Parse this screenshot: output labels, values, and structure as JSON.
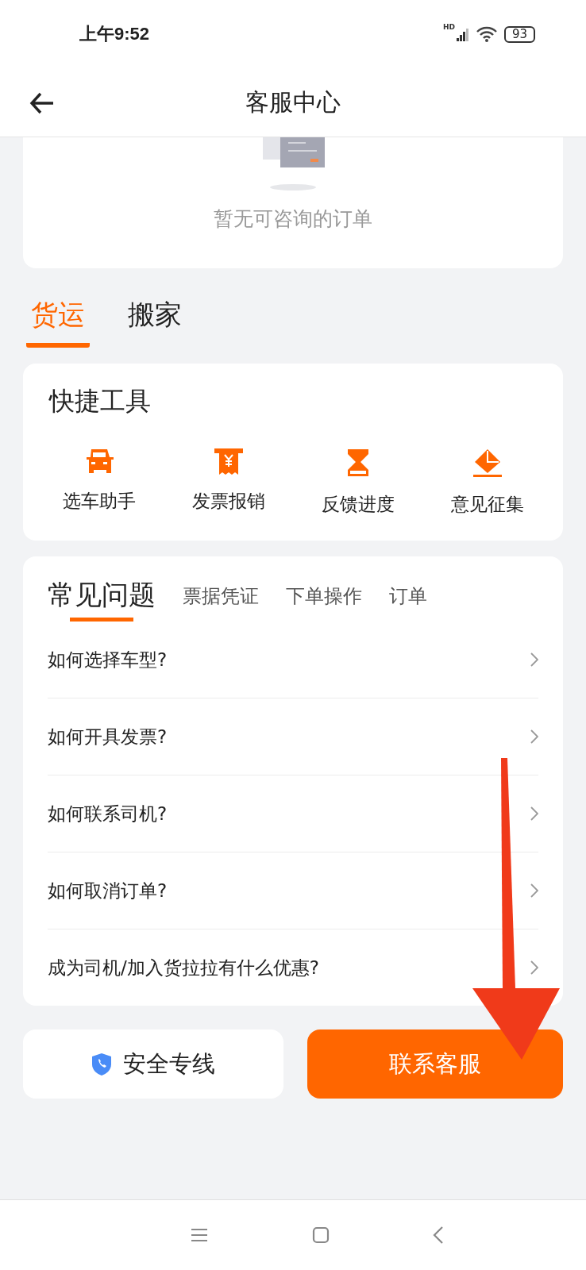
{
  "status_bar": {
    "time": "上午9:52",
    "network_label": "HD",
    "battery": "93"
  },
  "header": {
    "title": "客服中心"
  },
  "orders_card": {
    "empty_text": "暂无可咨询的订单"
  },
  "category_tabs": [
    {
      "label": "货运",
      "selected": true
    },
    {
      "label": "搬家",
      "selected": false
    }
  ],
  "quick_tools": {
    "title": "快捷工具",
    "items": [
      {
        "label": "选车助手",
        "kind": "car"
      },
      {
        "label": "发票报销",
        "kind": "invoice"
      },
      {
        "label": "反馈进度",
        "kind": "hourglass"
      },
      {
        "label": "意见征集",
        "kind": "feedback"
      }
    ]
  },
  "faq": {
    "tabs": [
      {
        "label": "常见问题",
        "selected": true
      },
      {
        "label": "票据凭证",
        "selected": false
      },
      {
        "label": "下单操作",
        "selected": false
      },
      {
        "label": "订单",
        "selected": false
      }
    ],
    "questions": [
      "如何选择车型?",
      "如何开具发票?",
      "如何联系司机?",
      "如何取消订单?",
      "成为司机/加入货拉拉有什么优惠?"
    ]
  },
  "buttons": [
    {
      "label": "安全专线",
      "kind": "secondary"
    },
    {
      "label": "联系客服",
      "kind": "primary"
    }
  ],
  "annotation": {
    "kind": "arrow"
  }
}
